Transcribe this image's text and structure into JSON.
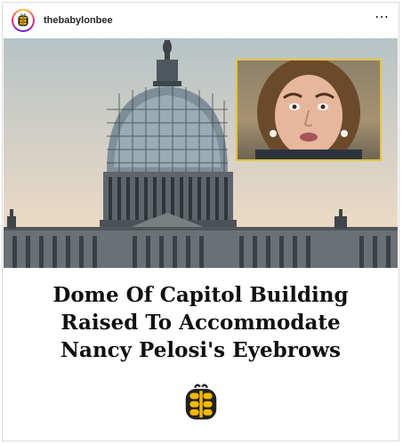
{
  "post": {
    "username": "thebabylonbee",
    "more_icon": "ellipsis-icon",
    "avatar_icon": "babylon-bee-logo-icon"
  },
  "image": {
    "background_scene": "capitol-dome-under-scaffolding",
    "inset_photo_border_color": "#e5c53c"
  },
  "headline": {
    "line1": "Dome Of Capitol Building",
    "line2": "Raised To Accommodate",
    "line3": "Nancy Pelosi's Eyebrows"
  },
  "colors": {
    "logo_yellow": "#f5b800",
    "logo_dark": "#222222"
  }
}
